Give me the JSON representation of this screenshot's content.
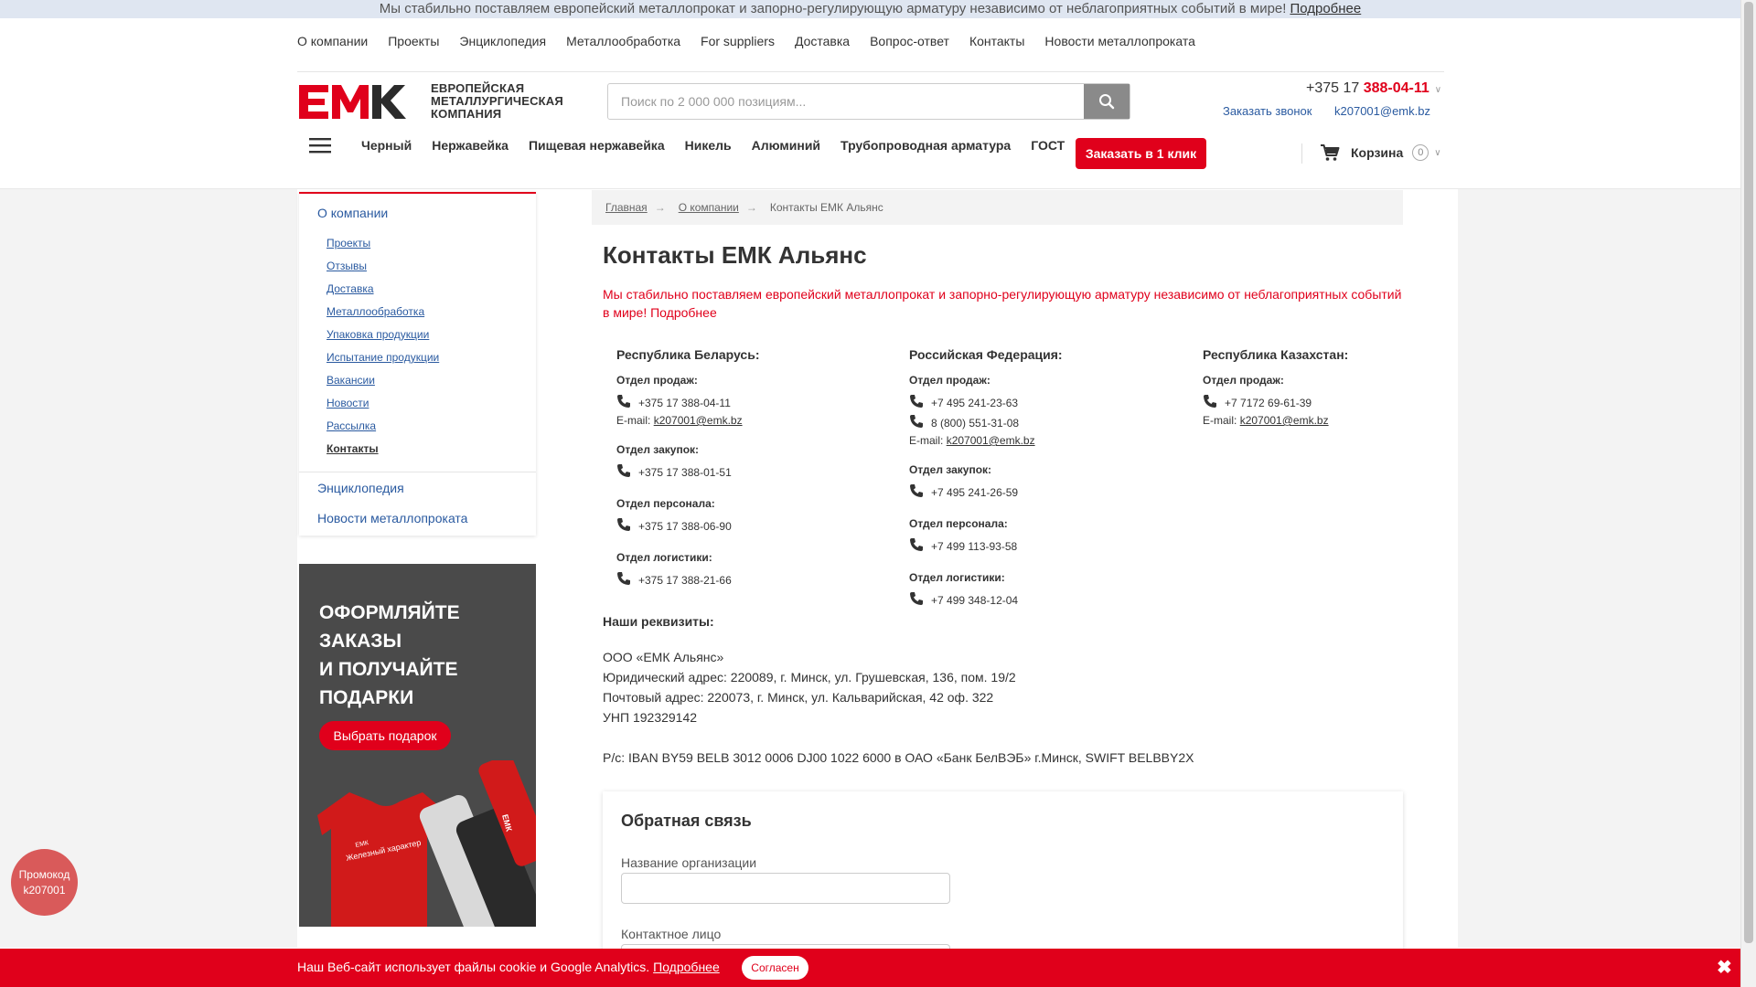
{
  "top_banner": {
    "text": "Мы стабильно поставляем европейский металлопрокат и запорно-регулирующую арматуру независимо от неблагоприятных событий в мире!",
    "link": "Подробнее"
  },
  "topnav": [
    "О компании",
    "Проекты",
    "Энциклопедия",
    "Металлообработка",
    "For suppliers",
    "Доставка",
    "Вопрос-ответ",
    "Контакты",
    "Новости металлопроката"
  ],
  "logo": {
    "mark": "ЕМК",
    "line1": "ЕВРОПЕЙСКАЯ",
    "line2": "МЕТАЛЛУРГИЧЕСКАЯ",
    "line3": "КОМПАНИЯ"
  },
  "search": {
    "placeholder": "Поиск по 2 000 000 позициям..."
  },
  "header": {
    "phone_prefix": "+375 17",
    "phone_main": "388-04-11",
    "callback": "Заказать звонок",
    "email": "k207001@emk.bz"
  },
  "catnav": [
    "Черный",
    "Нержавейка",
    "Пищевая нержавейка",
    "Никель",
    "Алюминий",
    "Трубопроводная арматура",
    "ГОСТ"
  ],
  "order_button": "Заказать в 1 клик",
  "cart": {
    "label": "Корзина",
    "count": "0"
  },
  "sidemenu": {
    "section_company": "О компании",
    "items": [
      "Проекты",
      "Отзывы",
      "Доставка",
      "Металлообработка",
      "Упаковка продукции",
      "Испытание продукции",
      "Вакансии",
      "Новости",
      "Рассылка",
      "Контакты"
    ],
    "section_encyclopedia": "Энциклопедия",
    "section_news": "Новости металлопроката"
  },
  "promo_banner": {
    "line1": "ОФОРМЛЯЙТЕ",
    "line2": "ЗАКАЗЫ",
    "line3": "И ПОЛУЧАЙТЕ",
    "line4": "ПОДАРКИ",
    "button": "Выбрать подарок",
    "shirt_text": "Железный характер"
  },
  "breadcrumb": {
    "home": "Главная",
    "company": "О компании",
    "current": "Контакты ЕМК Альянс"
  },
  "page_title": "Контакты ЕМК Альянс",
  "notice": "Мы стабильно поставляем европейский металлопрокат и запорно-регулирующую арматуру независимо от неблагоприятных событий в мире! Подробнее",
  "belarus": {
    "country": "Республика Беларусь:",
    "sales_label": "Отдел продаж:",
    "sales_phone": "+375 17 388-04-11",
    "email_label": "E-mail:",
    "email": "k207001@emk.bz",
    "purchase_label": "Отдел закупок:",
    "purchase_phone": "+375 17 388-01-51",
    "hr_label": "Отдел персонала:",
    "hr_phone": "+375 17 388-06-90",
    "logistics_label": "Отдел логистики:",
    "logistics_phone": "+375 17 388-21-66"
  },
  "russia": {
    "country": "Российская Федерация:",
    "sales_label": "Отдел продаж:",
    "sales_phone": "+7 495 241-23-63",
    "sales_phone2": "8 (800) 551-31-08",
    "email_label": "E-mail:",
    "email": "k207001@emk.bz",
    "purchase_label": "Отдел закупок:",
    "purchase_phone": "+7 495 241-26-59",
    "hr_label": "Отдел персонала:",
    "hr_phone": "+7 499 113-93-58",
    "logistics_label": "Отдел логистики:",
    "logistics_phone": "+7 499 348-12-04"
  },
  "kazakhstan": {
    "country": "Республика Казахстан:",
    "sales_label": "Отдел продаж:",
    "sales_phone": "+7 7172 69-61-39",
    "email_label": "E-mail:",
    "email": "k207001@emk.bz"
  },
  "requisites": {
    "title": "Наши реквизиты:",
    "company": "ООО «ЕМК Альянс»",
    "legal_address": "Юридический адрес: 220089, г. Минск, ул. Грушевская, 136, пом. 19/2",
    "postal_address": "Почтовый адрес: 220073, г. Минск, ул. Кальварийская, 42 оф. 322",
    "unp": "УНП 192329142",
    "bank": "Р/с: IBAN BY59 BELB 3012 0006 DJ00 1022 6000 в ОАО «Банк БелВЭБ» г.Минск, SWIFT BELBBY2X"
  },
  "feedback": {
    "title": "Обратная связь",
    "org_label": "Название организации",
    "contact_label": "Контактное лицо"
  },
  "promo_circle": {
    "line1": "Промокод",
    "line2": "k207001"
  },
  "cookie": {
    "text": "Наш Веб-сайт использует файлы cookie и Google Analytics.",
    "link": "Подробнее",
    "accept": "Согласен"
  },
  "colors": {
    "accent": "#e0001b",
    "link": "#2a5aa0",
    "banner_bg": "#dfe6f1"
  }
}
